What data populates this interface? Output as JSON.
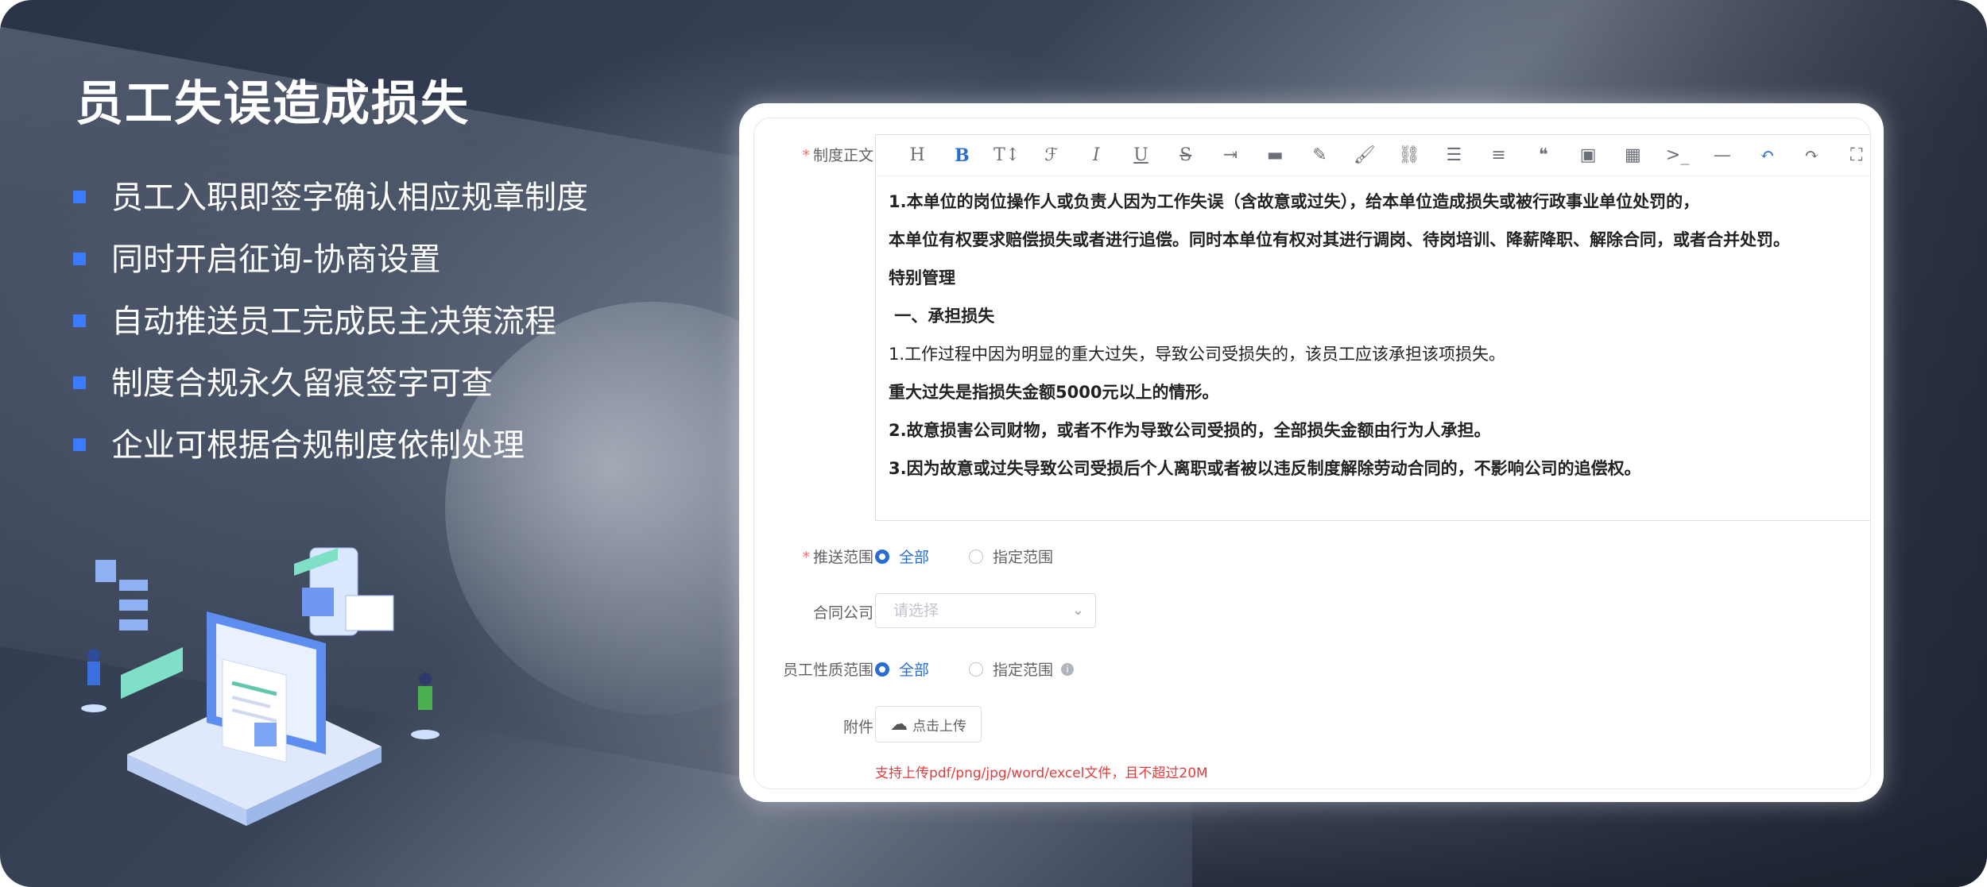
{
  "heading": "员工失误造成损失",
  "features": [
    "员工入职即签字确认相应规章制度",
    "同时开启征询-协商设置",
    "自动推送员工完成民主决策流程",
    "制度合规永久留痕签字可查",
    "企业可根据合规制度依制处理"
  ],
  "form": {
    "policy_label": "制度正文",
    "toolbar_icons": [
      "heading-icon",
      "bold-icon",
      "font-size-icon",
      "font-family-icon",
      "italic-icon",
      "underline-icon",
      "strikethrough-icon",
      "indent-icon",
      "line-height-icon",
      "font-color-icon",
      "background-color-icon",
      "link-icon",
      "bullet-list-icon",
      "align-icon",
      "quote-icon",
      "image-icon",
      "table-icon",
      "code-icon",
      "divider-icon",
      "undo-icon",
      "redo-icon",
      "fullscreen-icon"
    ],
    "content_lines": [
      "1.本单位的岗位操作人或负责人因为工作失误（含故意或过失），给本单位造成损失或被行政事业单位处罚的，",
      "本单位有权要求赔偿损失或者进行追偿。同时本单位有权对其进行调岗、待岗培训、降薪降职、解除合同，或者合并处罚。",
      "特别管理",
      " 一、承担损失",
      "1.工作过程中因为明显的重大过失，导致公司受损失的，该员工应该承担该项损失。",
      "重大过失是指损失金额5000元以上的情形。",
      "2.故意损害公司财物，或者不作为导致公司受损的，全部损失金额由行为人承担。",
      "3.因为故意或过失导致公司受损后个人离职或者被以违反制度解除劳动合同的，不影响公司的追偿权。"
    ],
    "push_scope_label": "推送范围",
    "push_scope_options": [
      "全部",
      "指定范围"
    ],
    "contract_company_label": "合同公司",
    "contract_company_placeholder": "请选择",
    "employee_type_label": "员工性质范围",
    "employee_type_options": [
      "全部",
      "指定范围"
    ],
    "attachment_label": "附件",
    "upload_label": "点击上传",
    "upload_hint": "支持上传pdf/png/jpg/word/excel文件，且不超过20M"
  },
  "colors": {
    "accent": "#2b6cd4",
    "bullet": "#3a7bff",
    "required": "#f56c6c",
    "hint": "#e23d3d"
  }
}
